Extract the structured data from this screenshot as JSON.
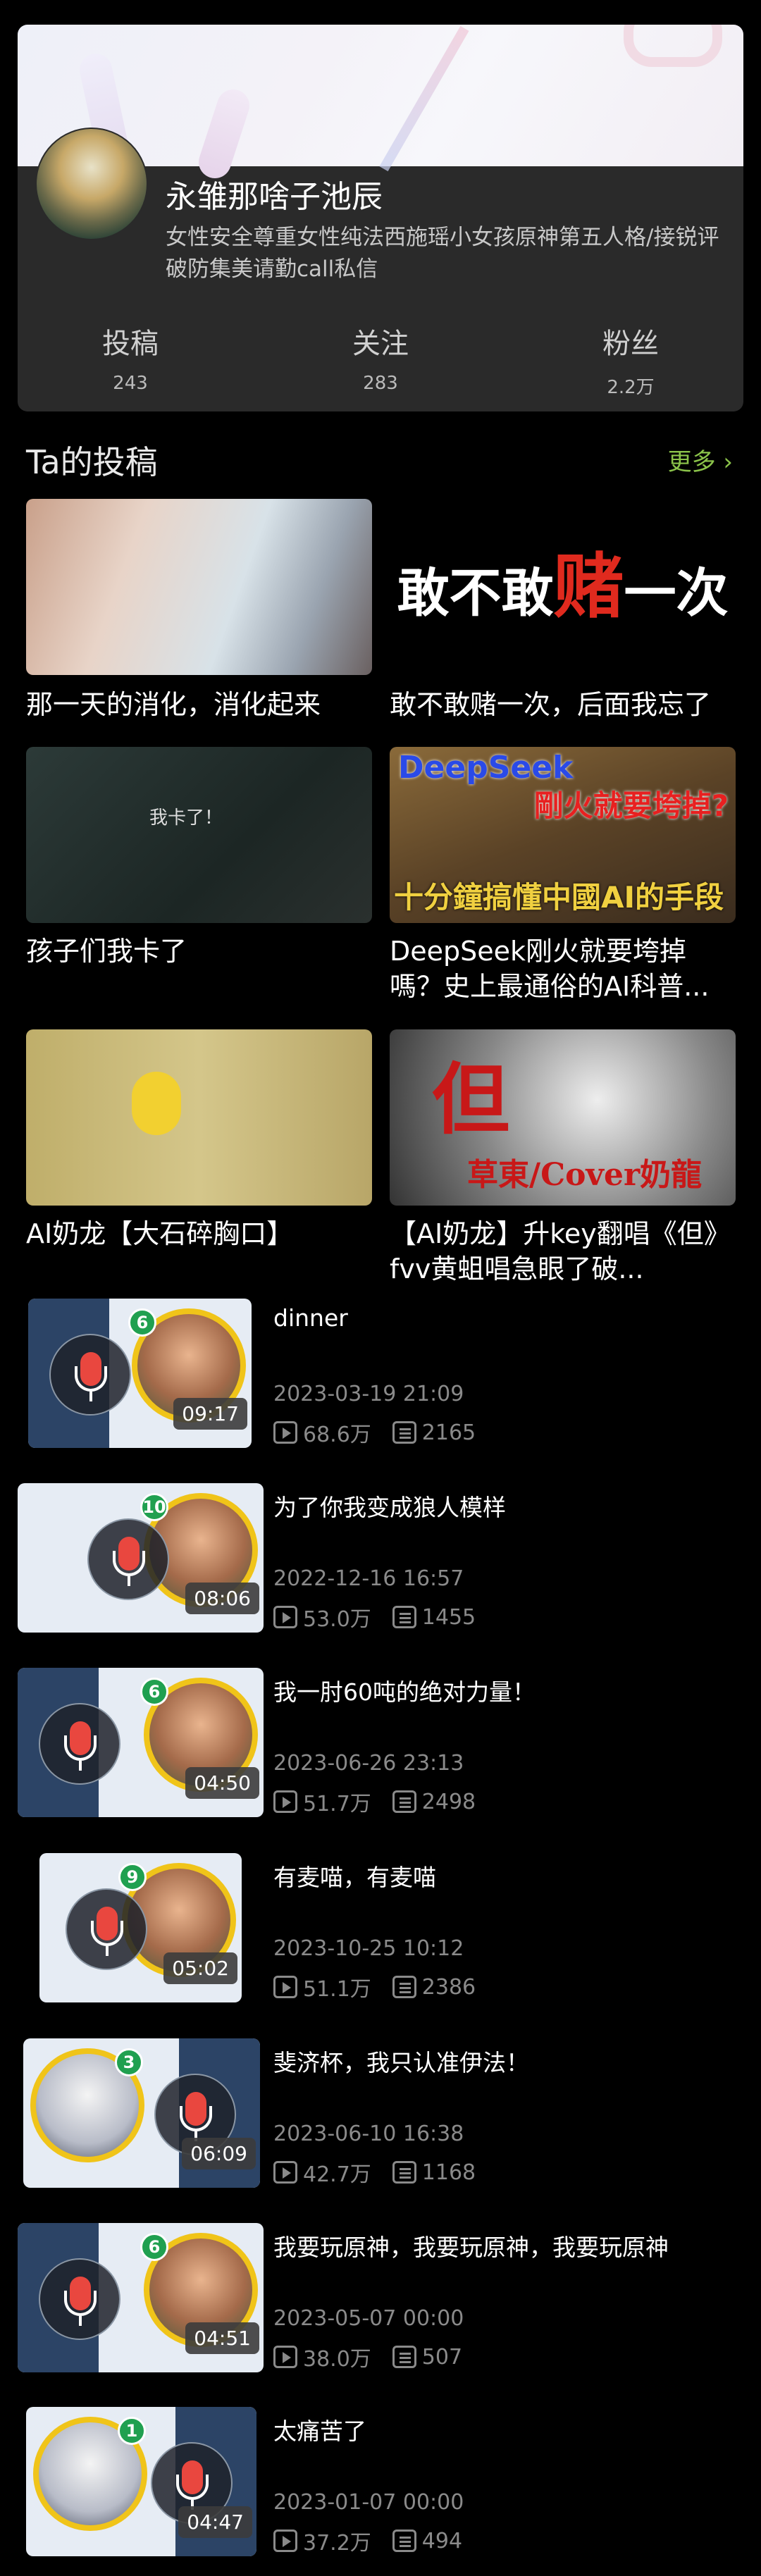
{
  "profile": {
    "name": "永雏那啥子池辰",
    "bio": "女性安全尊重女性纯法西施瑶小女孩原神第五人格/接锐评破防集美请勤call私信",
    "stats": [
      {
        "label": "投稿",
        "value": "243"
      },
      {
        "label": "关注",
        "value": "283"
      },
      {
        "label": "粉丝",
        "value": "2.2万"
      }
    ]
  },
  "section": {
    "title": "Ta的投稿",
    "more": "更多 ›"
  },
  "grid": [
    {
      "title": "那一天的消化，消化起来"
    },
    {
      "title": "敢不敢赌一次，后面我忘了",
      "cover_text_a": "敢不敢",
      "cover_text_b": "赌",
      "cover_text_c": "一次"
    },
    {
      "title": "孩子们我卡了",
      "cover_text": "我卡了！"
    },
    {
      "title": "DeepSeek刚火就要垮掉嗎？史上最通俗的AI科普...",
      "cover_text_a": "DeepSeek",
      "cover_text_b": "剛火就要垮掉?",
      "cover_text_c": "十分鐘搞懂中國AI的手段"
    },
    {
      "title": "AI奶龙【大石碎胸口】"
    },
    {
      "title": "【AI奶龙】升key翻唱《但》fvv黄蛆唱急眼了破...",
      "cover_text_a": "但",
      "cover_text_b": "草東/Cover奶龍"
    }
  ],
  "list": [
    {
      "title": "dinner",
      "date": "2023-03-19 21:09",
      "views": "68.6万",
      "danmaku": "2165",
      "duration": "09:17",
      "level": "6"
    },
    {
      "title": "为了你我变成狼人模样",
      "date": "2022-12-16 16:57",
      "views": "53.0万",
      "danmaku": "1455",
      "duration": "08:06",
      "level": "10"
    },
    {
      "title": "我一肘60吨的绝对力量！",
      "date": "2023-06-26 23:13",
      "views": "51.7万",
      "danmaku": "2498",
      "duration": "04:50",
      "level": "6"
    },
    {
      "title": "有麦喵，有麦喵",
      "date": "2023-10-25 10:12",
      "views": "51.1万",
      "danmaku": "2386",
      "duration": "05:02",
      "level": "9"
    },
    {
      "title": "斐济杯，我只认准伊法！",
      "date": "2023-06-10 16:38",
      "views": "42.7万",
      "danmaku": "1168",
      "duration": "06:09",
      "level": "3"
    },
    {
      "title": "我要玩原神，我要玩原神，我要玩原神",
      "date": "2023-05-07 00:00",
      "views": "38.0万",
      "danmaku": "507",
      "duration": "04:51",
      "level": "6"
    },
    {
      "title": "太痛苦了",
      "date": "2023-01-07 00:00",
      "views": "37.2万",
      "danmaku": "494",
      "duration": "04:47",
      "level": "1"
    }
  ],
  "colors": {
    "accent": "#8bc34a",
    "card": "#2a2a2a",
    "mic": "#e9473f"
  }
}
